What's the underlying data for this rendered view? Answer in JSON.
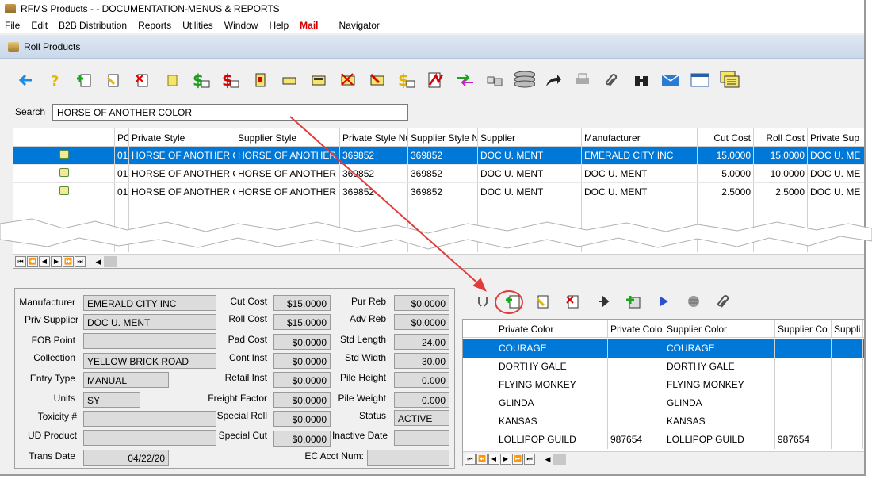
{
  "window": {
    "title": "RFMS Products - - DOCUMENTATION-MENUS & REPORTS"
  },
  "menu": [
    "File",
    "Edit",
    "B2B Distribution",
    "Reports",
    "Utilities",
    "Window",
    "Help",
    "Mail",
    "Navigator"
  ],
  "subwindow": {
    "title": "Roll Products"
  },
  "toolbar": {
    "icons": [
      "back-arrow-icon",
      "help-icon",
      "new-icon",
      "edit-icon",
      "delete-icon",
      "note-icon",
      "price-icon",
      "price-red-icon",
      "bookmark-icon",
      "label-icon",
      "card-icon",
      "card-delete-icon",
      "card-edit-icon",
      "cost-icon",
      "signature-icon",
      "transfer-icon",
      "link-icon",
      "stack-icon",
      "forward-icon",
      "print-icon",
      "attach-icon",
      "binoculars-icon",
      "mail-icon",
      "window-icon",
      "notes-icon"
    ]
  },
  "search": {
    "label": "Search",
    "value": "HORSE OF ANOTHER COLOR"
  },
  "products_grid": {
    "columns": [
      "",
      "PC",
      "Private Style",
      "Supplier Style",
      "Private Style Nu",
      "Supplier Style N",
      "Supplier",
      "Manufacturer",
      "Cut Cost",
      "Roll Cost",
      "Private Sup"
    ],
    "rows": [
      [
        "",
        "01",
        "HORSE OF ANOTHER CO",
        "HORSE OF ANOTHER CO",
        "369852",
        "369852",
        "DOC U. MENT",
        "EMERALD CITY INC",
        "15.0000",
        "15.0000",
        "DOC U. ME"
      ],
      [
        "",
        "01",
        "HORSE OF ANOTHER CO",
        "HORSE OF ANOTHER CO",
        "369852",
        "369852",
        "DOC U. MENT",
        "DOC U. MENT",
        "5.0000",
        "10.0000",
        "DOC U. ME"
      ],
      [
        "",
        "01",
        "HORSE OF ANOTHER CO",
        "HORSE OF ANOTHER CO",
        "369852",
        "369852",
        "DOC U. MENT",
        "DOC U. MENT",
        "2.5000",
        "2.5000",
        "DOC U. ME"
      ]
    ],
    "selected_row": 0
  },
  "detail": {
    "manufacturer": {
      "label": "Manufacturer",
      "value": "EMERALD CITY INC"
    },
    "priv_supplier": {
      "label": "Priv Supplier",
      "value": "DOC U. MENT"
    },
    "fob_point": {
      "label": "FOB Point",
      "value": ""
    },
    "collection": {
      "label": "Collection",
      "value": "YELLOW BRICK ROAD"
    },
    "entry_type": {
      "label": "Entry Type",
      "value": "MANUAL"
    },
    "units": {
      "label": "Units",
      "value": "SY"
    },
    "toxicity": {
      "label": "Toxicity #",
      "value": ""
    },
    "ud_product": {
      "label": "UD Product",
      "value": ""
    },
    "trans_date": {
      "label": "Trans Date",
      "value": "04/22/20"
    },
    "cut_cost": {
      "label": "Cut Cost",
      "value": "$15.0000"
    },
    "roll_cost": {
      "label": "Roll Cost",
      "value": "$15.0000"
    },
    "pad_cost": {
      "label": "Pad Cost",
      "value": "$0.0000"
    },
    "cont_inst": {
      "label": "Cont Inst",
      "value": "$0.0000"
    },
    "retail_inst": {
      "label": "Retail Inst",
      "value": "$0.0000"
    },
    "freight_factor": {
      "label": "Freight Factor",
      "value": "$0.0000"
    },
    "special_roll": {
      "label": "Special Roll",
      "value": "$0.0000"
    },
    "special_cut": {
      "label": "Special Cut",
      "value": "$0.0000"
    },
    "pur_reb": {
      "label": "Pur Reb",
      "value": "$0.0000"
    },
    "adv_reb": {
      "label": "Adv Reb",
      "value": "$0.0000"
    },
    "std_length": {
      "label": "Std Length",
      "value": "24.00"
    },
    "std_width": {
      "label": "Std Width",
      "value": "30.00"
    },
    "pile_height": {
      "label": "Pile Height",
      "value": "0.000"
    },
    "pile_weight": {
      "label": "Pile Weight",
      "value": "0.000"
    },
    "status": {
      "label": "Status",
      "value": "ACTIVE"
    },
    "inactive_date": {
      "label": "Inactive Date",
      "value": ""
    },
    "ec_acct_num": {
      "label": "EC Acct Num:",
      "value": ""
    }
  },
  "colors_toolbar": {
    "icons": [
      "filter-icon",
      "add-icon",
      "edit-icon",
      "delete-icon",
      "arrow-right-icon",
      "copy-add-icon",
      "play-icon",
      "globe-icon",
      "attach-icon"
    ]
  },
  "colors_grid": {
    "columns": [
      "Private Color",
      "Private Colo",
      "Supplier Color",
      "Supplier Co",
      "Suppli"
    ],
    "rows": [
      [
        "COURAGE",
        "",
        "COURAGE",
        "",
        ""
      ],
      [
        "DORTHY GALE",
        "",
        "DORTHY GALE",
        "",
        ""
      ],
      [
        "FLYING MONKEY",
        "",
        "FLYING MONKEY",
        "",
        ""
      ],
      [
        "GLINDA",
        "",
        "GLINDA",
        "",
        ""
      ],
      [
        "KANSAS",
        "",
        "KANSAS",
        "",
        ""
      ],
      [
        "LOLLIPOP GUILD",
        "987654",
        "LOLLIPOP GUILD",
        "987654",
        ""
      ]
    ],
    "selected_row": 0
  },
  "nav_buttons": [
    "⏮",
    "⏪",
    "◀",
    "▶",
    "⏩",
    "⏭"
  ],
  "colors": {
    "selection": "#0078d7",
    "annotation": "#e23b3b",
    "mail": "#d40000"
  }
}
